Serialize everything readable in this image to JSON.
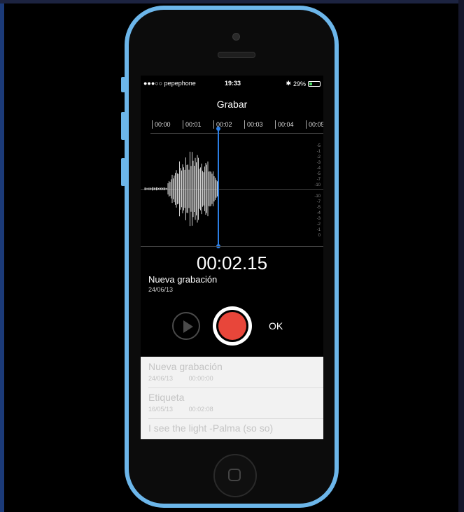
{
  "status_bar": {
    "carrier": "●●●○○ pepephone",
    "time": "19:33",
    "battery": "29%",
    "battery_level": 0.29
  },
  "screen_title": "Grabar",
  "timeline": {
    "ticks": [
      "00:00",
      "00:01",
      "00:02",
      "00:03",
      "00:04",
      "00:05"
    ]
  },
  "db_scale_top": [
    "-5",
    "-1",
    "-2",
    "-3",
    "-4",
    "-5",
    "-7",
    "-10"
  ],
  "db_scale_bottom": [
    "-10",
    "-7",
    "-5",
    "-4",
    "-3",
    "-2",
    "-1",
    "0"
  ],
  "recording": {
    "elapsed": "00:02.15",
    "name": "Nueva grabación",
    "date": "24/06/13"
  },
  "controls": {
    "ok_label": "OK"
  },
  "recordings_list": [
    {
      "title": "Nueva grabación",
      "date": "24/06/13",
      "duration": "00:00:00"
    },
    {
      "title": "Etiqueta",
      "date": "16/05/13",
      "duration": "00:02:08"
    },
    {
      "title": "I see the light -Palma (so so)",
      "date": "",
      "duration": ""
    }
  ],
  "colors": {
    "phone_body": "#6cb6ea",
    "record": "#e8463a",
    "playhead": "#2c7fe6",
    "battery": "#4cd964"
  }
}
